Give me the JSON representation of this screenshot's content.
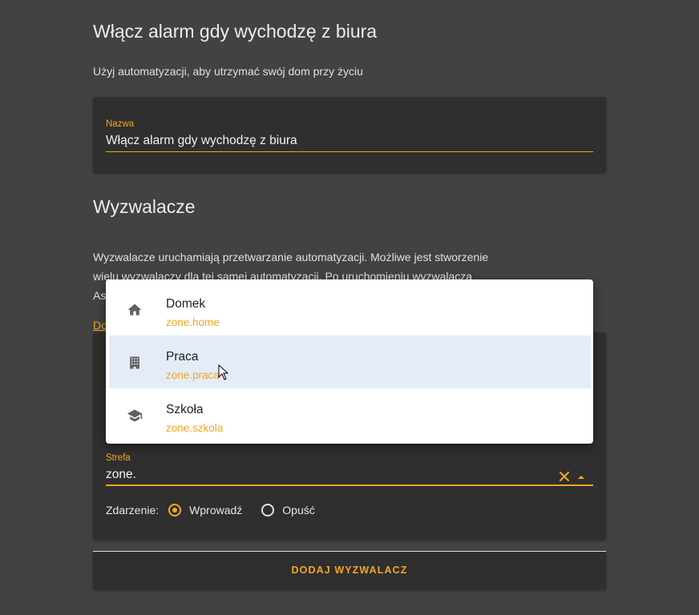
{
  "automation": {
    "title": "Włącz alarm gdy wychodzę z biura",
    "intro": "Użyj automatyzacji, aby utrzymać swój dom przy życiu",
    "name_label": "Nazwa",
    "name_value": "Włącz alarm gdy wychodzę z biura"
  },
  "triggers": {
    "heading": "Wyzwalacze",
    "description": "Wyzwalacze uruchamiają przetwarzanie automatyzacji. Możliwe jest stworzenie wielu wyzwalaczy dla tej samej automatyzacji. Po uruchomieniu wyzwalacza Asystent",
    "link_text": "Do",
    "zone_label": "Strefa",
    "zone_value": "zone.",
    "event_label": "Zdarzenie:",
    "event_options": [
      "Wprowadź",
      "Opuść"
    ],
    "event_selected": "Wprowadź",
    "add_button": "DODAJ WYZWALACZ"
  },
  "dropdown": {
    "options": [
      {
        "name": "Domek",
        "entity": "zone.home",
        "icon": "home-icon"
      },
      {
        "name": "Praca",
        "entity": "zone.praca",
        "icon": "office-building-icon"
      },
      {
        "name": "Szkoła",
        "entity": "zone.szkola",
        "icon": "school-icon"
      }
    ],
    "highlighted": "Praca"
  },
  "colors": {
    "accent": "#f5a623",
    "background": "#424242",
    "card": "#2f2f2f",
    "highlight": "#e4ecf7"
  }
}
